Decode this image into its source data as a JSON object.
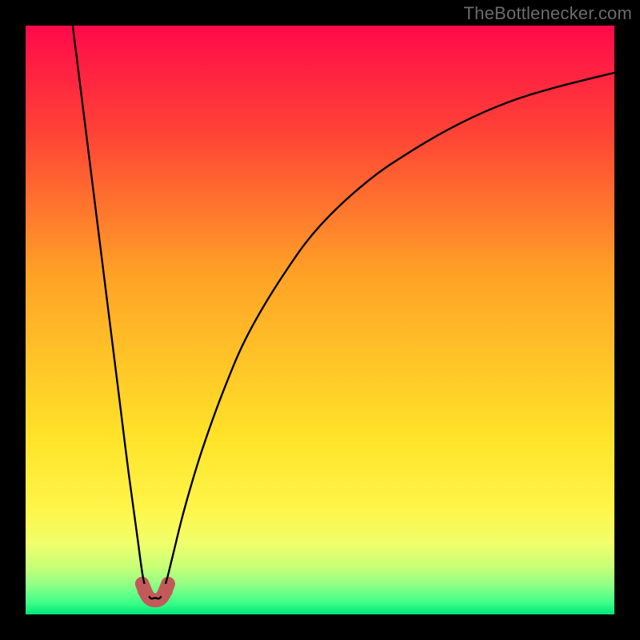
{
  "watermark": "TheBottlenecker.com",
  "chart_data": {
    "type": "line",
    "title": "",
    "xlabel": "",
    "ylabel": "",
    "xlim": [
      0,
      100
    ],
    "ylim": [
      0,
      100
    ],
    "grid": false,
    "legend": false,
    "annotations": [],
    "background_gradient_stops": [
      {
        "pos": 1.0,
        "color": "#ff0a4a"
      },
      {
        "pos": 0.82,
        "color": "#ff4236"
      },
      {
        "pos": 0.58,
        "color": "#ffa126"
      },
      {
        "pos": 0.3,
        "color": "#ffe329"
      },
      {
        "pos": 0.18,
        "color": "#fff549"
      },
      {
        "pos": 0.12,
        "color": "#f0ff6b"
      },
      {
        "pos": 0.08,
        "color": "#c7ff77"
      },
      {
        "pos": 0.05,
        "color": "#8fff86"
      },
      {
        "pos": 0.02,
        "color": "#3eff88"
      },
      {
        "pos": 0.0,
        "color": "#00e57a"
      }
    ],
    "series": [
      {
        "name": "curve",
        "color": "#000000",
        "points": [
          {
            "x": 8.0,
            "y": 100.0
          },
          {
            "x": 10.0,
            "y": 84.0
          },
          {
            "x": 12.0,
            "y": 68.0
          },
          {
            "x": 14.0,
            "y": 52.0
          },
          {
            "x": 16.0,
            "y": 36.0
          },
          {
            "x": 17.5,
            "y": 24.0
          },
          {
            "x": 19.0,
            "y": 13.0
          },
          {
            "x": 20.0,
            "y": 6.0
          },
          {
            "x": 21.0,
            "y": 3.0
          },
          {
            "x": 22.0,
            "y": 2.8
          },
          {
            "x": 23.0,
            "y": 3.0
          },
          {
            "x": 24.0,
            "y": 6.0
          },
          {
            "x": 25.0,
            "y": 10.0
          },
          {
            "x": 27.0,
            "y": 18.0
          },
          {
            "x": 30.0,
            "y": 28.0
          },
          {
            "x": 34.0,
            "y": 39.0
          },
          {
            "x": 38.0,
            "y": 48.0
          },
          {
            "x": 44.0,
            "y": 58.0
          },
          {
            "x": 50.0,
            "y": 66.0
          },
          {
            "x": 58.0,
            "y": 73.5
          },
          {
            "x": 66.0,
            "y": 79.0
          },
          {
            "x": 74.0,
            "y": 83.5
          },
          {
            "x": 82.0,
            "y": 87.0
          },
          {
            "x": 90.0,
            "y": 89.5
          },
          {
            "x": 100.0,
            "y": 92.0
          }
        ]
      }
    ],
    "markers": [
      {
        "name": "left-dot",
        "x": 20.2,
        "y": 4.0,
        "r": 1.2,
        "color": "#c35a5a"
      },
      {
        "name": "right-dot",
        "x": 23.8,
        "y": 4.0,
        "r": 1.2,
        "color": "#c35a5a"
      }
    ],
    "valley_band": {
      "color": "#c35a5a",
      "points": [
        {
          "x": 19.8,
          "y": 5.2
        },
        {
          "x": 20.8,
          "y": 3.0
        },
        {
          "x": 22.0,
          "y": 2.4
        },
        {
          "x": 23.2,
          "y": 3.0
        },
        {
          "x": 24.2,
          "y": 5.2
        }
      ],
      "width": 2.4
    }
  }
}
